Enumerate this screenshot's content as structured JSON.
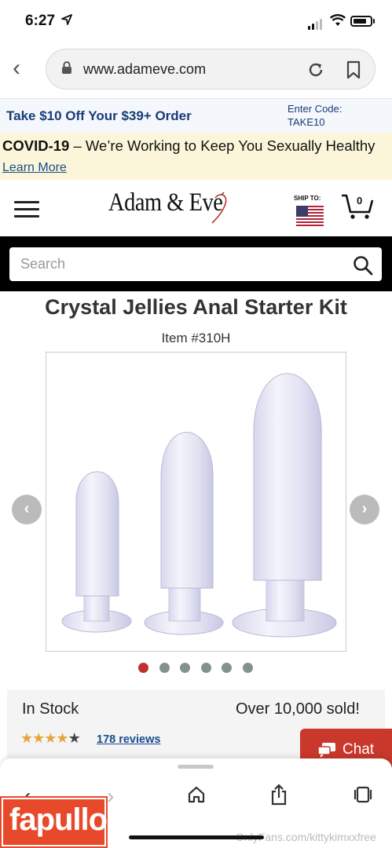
{
  "status_bar": {
    "time": "6:27"
  },
  "browser": {
    "url": "www.adameve.com"
  },
  "promo": {
    "offer": "Take $10 Off Your $39+ Order",
    "code_line1": "Enter Code:",
    "code_line2": "TAKE10"
  },
  "covid": {
    "bold": "COVID-19",
    "text": " – We’re Working to Keep You Sexually Healthy ",
    "link": "Learn More"
  },
  "header": {
    "logo": "Adam & Eve",
    "ship_to": "SHIP TO:",
    "cart_count": "0"
  },
  "search": {
    "placeholder": "Search"
  },
  "product": {
    "title": "Crystal Jellies Anal Starter Kit",
    "item_number": "Item #310H",
    "carousel_total": 6,
    "carousel_active": 1,
    "stock": "In Stock",
    "sold": "Over 10,000 sold!",
    "rating": 4.5,
    "reviews": "178 reviews"
  },
  "chat": {
    "label": "Chat"
  },
  "watermark": {
    "brand": "fapullo",
    "text": "OnlyFans.com/kittykimxxfree"
  },
  "colors": {
    "accent_red": "#c9382b",
    "link_blue": "#1a4d8c",
    "promo_navy": "#1a3b7a"
  }
}
